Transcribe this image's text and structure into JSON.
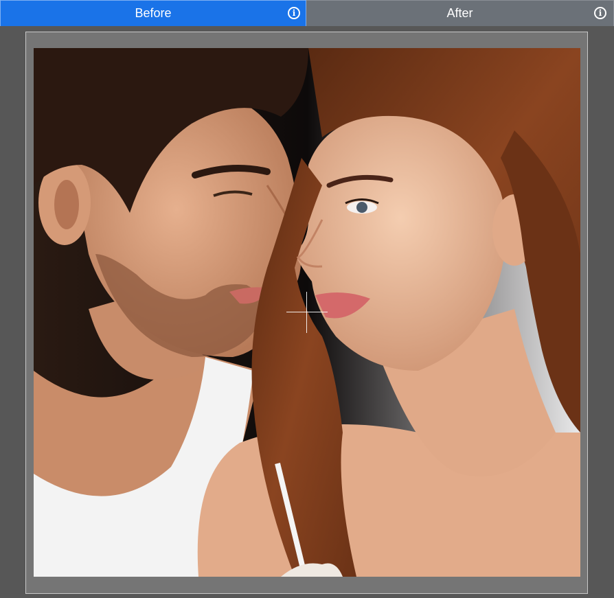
{
  "tabs": {
    "before": {
      "label": "Before",
      "icon": "info-icon",
      "active": true,
      "color": "#1a73e8"
    },
    "after": {
      "label": "After",
      "icon": "info-icon",
      "active": false,
      "color": "#6b7178"
    }
  },
  "info_glyph": "i",
  "colors": {
    "background": "#575757",
    "viewer_frame": "#757575"
  }
}
